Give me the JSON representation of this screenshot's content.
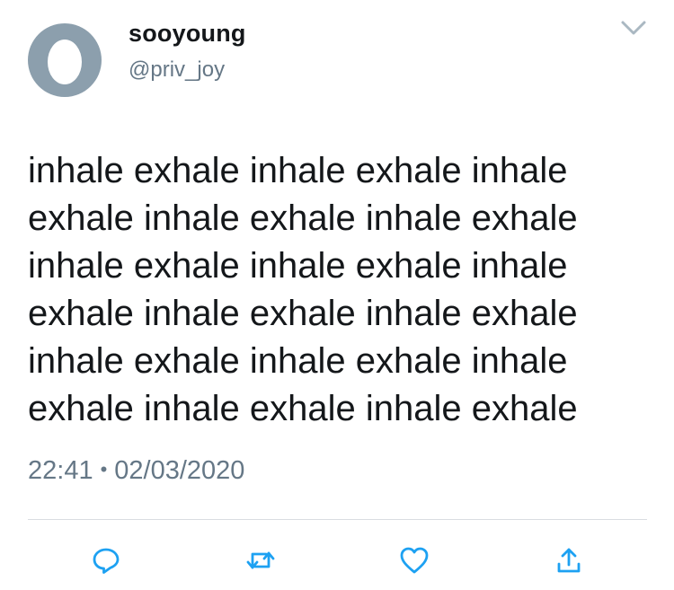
{
  "user": {
    "display_name": "sooyoung",
    "handle": "@priv_joy"
  },
  "tweet": {
    "lines": [
      "inhale exhale inhale exhale inhale",
      "exhale inhale exhale inhale exhale",
      "inhale exhale inhale exhale inhale",
      "exhale inhale exhale inhale exhale",
      "inhale exhale inhale exhale inhale",
      "exhale inhale exhale inhale exhale"
    ],
    "time": "22:41",
    "separator": "•",
    "date": "02/03/2020"
  },
  "icons": {
    "menu": "chevron-down-icon",
    "reply": "reply-icon",
    "retweet": "retweet-icon",
    "like": "heart-icon",
    "share": "share-icon"
  },
  "colors": {
    "text": "#14171a",
    "secondary": "#657786",
    "icon": "#1da1f2",
    "avatar_bg": "#8c9fad",
    "divider": "#d9dde1"
  }
}
